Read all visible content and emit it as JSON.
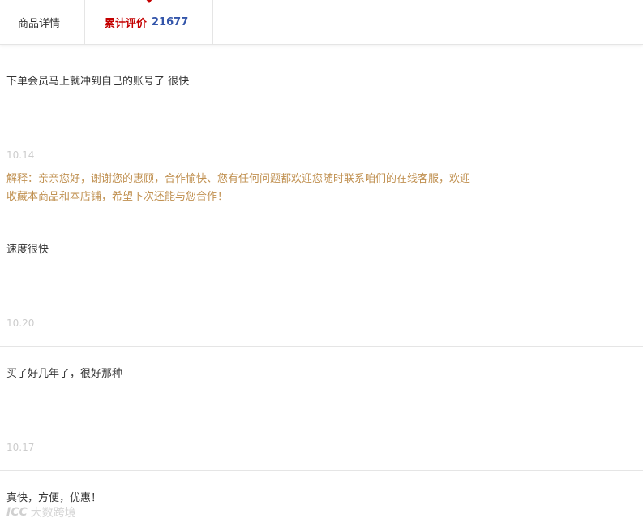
{
  "tabs": {
    "details_label": "商品详情",
    "reviews_label": "累计评价",
    "reviews_count": "21677"
  },
  "reviews": [
    {
      "text": "下单会员马上就冲到自己的账号了 很快",
      "date": "10.14",
      "reply": "解释：亲亲您好，谢谢您的惠顾，合作愉快、您有任何问题都欢迎您随时联系咱们的在线客服，欢迎收藏本商品和本店铺，希望下次还能与您合作！"
    },
    {
      "text": "速度很快",
      "date": "10.20"
    },
    {
      "text": "买了好几年了，很好那种",
      "date": "10.17"
    },
    {
      "text": "真快，方便，优惠！"
    }
  ],
  "watermark": {
    "logo": "ICC",
    "text": "大数跨境"
  },
  "colors": {
    "accent": "#c40000",
    "count": "#3355aa",
    "reply": "#c09050",
    "date": "#cccccc",
    "divider": "#e5e5e5"
  }
}
